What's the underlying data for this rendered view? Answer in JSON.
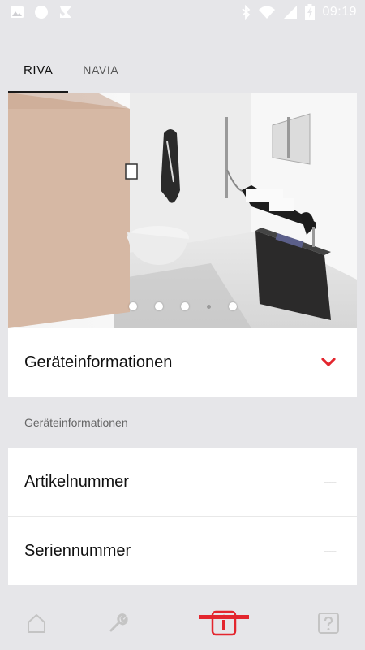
{
  "status_bar": {
    "time": "09:19",
    "left_icons": [
      "image-icon",
      "circle-icon",
      "check-icon"
    ],
    "right_icons": [
      "bluetooth-icon",
      "wifi-icon",
      "signal-icon",
      "battery-icon"
    ]
  },
  "tabs": [
    {
      "label": "RIVA",
      "active": true
    },
    {
      "label": "NAVIA",
      "active": false
    }
  ],
  "carousel": {
    "image": "bathroom-photo",
    "slide_count": 5,
    "active_index": 3
  },
  "device_info_dropdown": {
    "label": "Geräteinformationen",
    "icon": "chevron-down-icon",
    "accent": "#e3262e"
  },
  "section": {
    "title": "Geräteinformationen",
    "rows": [
      {
        "label": "Artikelnummer",
        "value": "-----"
      },
      {
        "label": "Seriennummer",
        "value": "-----"
      }
    ]
  },
  "bottom_nav": {
    "items": [
      {
        "name": "home-icon",
        "active": false
      },
      {
        "name": "wrench-icon",
        "active": false
      },
      {
        "name": "info-icon",
        "active": true
      },
      {
        "name": "help-icon",
        "active": false
      }
    ],
    "active_color": "#e3262e",
    "inactive_color": "#c4c4c4"
  }
}
